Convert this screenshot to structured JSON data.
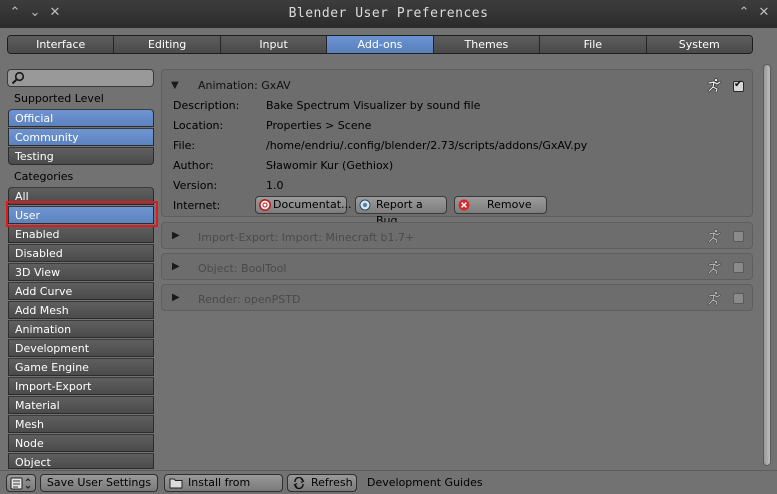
{
  "window": {
    "title": "Blender User Preferences"
  },
  "tabs": [
    "Interface",
    "Editing",
    "Input",
    "Add-ons",
    "Themes",
    "File",
    "System"
  ],
  "active_tab": "Add-ons",
  "sidebar": {
    "search_placeholder": "",
    "supported_level_label": "Supported Level",
    "levels": [
      "Official",
      "Community",
      "Testing"
    ],
    "categories_label": "Categories",
    "categories": [
      "All",
      "User",
      "Enabled",
      "Disabled",
      "3D View",
      "Add Curve",
      "Add Mesh",
      "Animation",
      "Development",
      "Game Engine",
      "Import-Export",
      "Material",
      "Mesh",
      "Node",
      "Object"
    ],
    "selected_category": "User"
  },
  "expanded_addon": {
    "title": "Animation: GxAV",
    "enabled": true,
    "fields": {
      "description_label": "Description:",
      "description": "Bake Spectrum Visualizer by sound file",
      "location_label": "Location:",
      "location": "Properties > Scene",
      "file_label": "File:",
      "file": "/home/endriu/.config/blender/2.73/scripts/addons/GxAV.py",
      "author_label": "Author:",
      "author": "Sławomir Kur (Gethiox)",
      "version_label": "Version:",
      "version": "1.0",
      "internet_label": "Internet:"
    },
    "buttons": {
      "documentation": "Documentat...",
      "report_bug": "Report a Bug",
      "remove": "Remove"
    }
  },
  "collapsed_addons": [
    {
      "title": "Import-Export: Import: Minecraft b1.7+",
      "enabled": false
    },
    {
      "title": "Object: BoolTool",
      "enabled": false
    },
    {
      "title": "Render: openPSTD",
      "enabled": false
    }
  ],
  "footer": {
    "save": "Save User Settings",
    "install": "Install from File...",
    "refresh": "Refresh",
    "dev_guides": "Development Guides"
  },
  "colors": {
    "accent": "#5c82bf",
    "highlight_box": "#e0191f"
  }
}
